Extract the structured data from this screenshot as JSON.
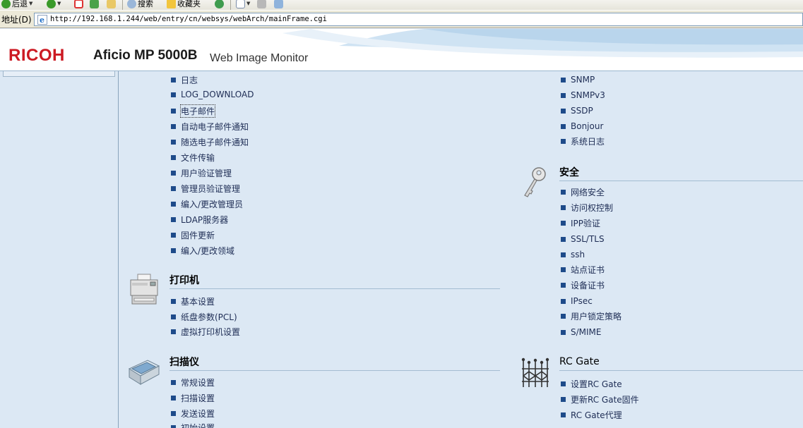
{
  "browser": {
    "toolbar": {
      "back_label": "后退",
      "search_label": "搜索",
      "favorites_label": "收藏夹"
    },
    "address": {
      "label": "地址(D)",
      "url": "http://192.168.1.244/web/entry/cn/websys/webArch/mainFrame.cgi"
    }
  },
  "header": {
    "brand": "RICOH",
    "model": "Aficio MP 5000B",
    "product": "Web Image Monitor"
  },
  "left_column": {
    "device_links": [
      "日志",
      "LOG_DOWNLOAD",
      "电子邮件",
      "自动电子邮件通知",
      "随选电子邮件通知",
      "文件传输",
      "用户验证管理",
      "管理员验证管理",
      "编入/更改管理员",
      "LDAP服务器",
      "固件更新",
      "编入/更改领域"
    ],
    "printer": {
      "title": "打印机",
      "links": [
        "基本设置",
        "纸盘参数(PCL)",
        "虚拟打印机设置"
      ]
    },
    "scanner": {
      "title": "扫描仪",
      "links": [
        "常规设置",
        "扫描设置",
        "发送设置",
        "初始设置"
      ]
    }
  },
  "right_column": {
    "network_links": [
      "SNMP",
      "SNMPv3",
      "SSDP",
      "Bonjour",
      "系统日志"
    ],
    "security": {
      "title": "安全",
      "links": [
        "网络安全",
        "访问权控制",
        "IPP验证",
        "SSL/TLS",
        "ssh",
        "站点证书",
        "设备证书",
        "IPsec",
        "用户锁定策略",
        "S/MIME"
      ]
    },
    "rcgate": {
      "title": "RC Gate",
      "links": [
        "设置RC Gate",
        "更新RC Gate固件",
        "RC Gate代理"
      ]
    }
  },
  "colors": {
    "background": "#dce8f4",
    "link": "#1e2d55",
    "bullet": "#1e4b8a",
    "brand_red": "#cc1a23"
  }
}
